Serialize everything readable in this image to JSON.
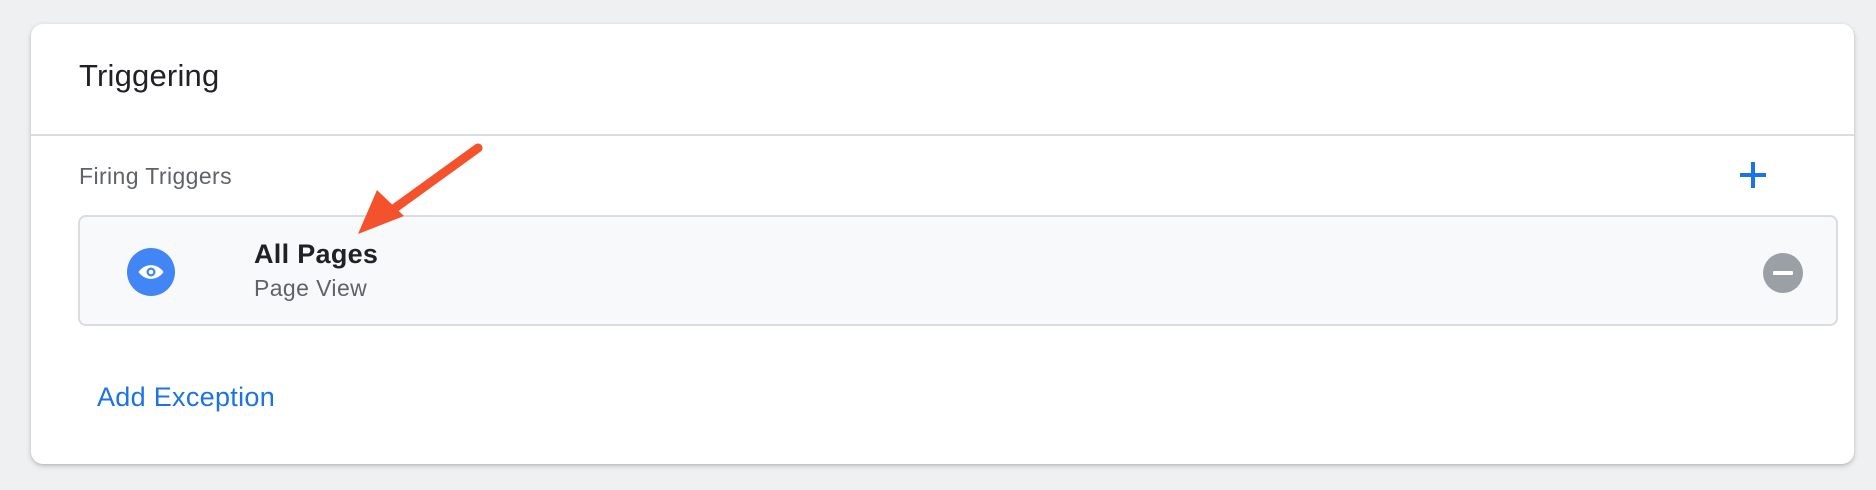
{
  "card": {
    "title": "Triggering"
  },
  "firing_triggers": {
    "label": "Firing Triggers",
    "add_icon": "plus-icon",
    "items": [
      {
        "name": "All Pages",
        "type": "Page View",
        "icon": "eye-icon",
        "remove_icon": "minus-circle-icon"
      }
    ]
  },
  "exceptions": {
    "add_label": "Add Exception"
  },
  "colors": {
    "accent": "#1a73e8",
    "trigger_icon_bg": "#4285f4",
    "remove_icon_bg": "#9aa0a6",
    "annotation_arrow": "#f4522d"
  }
}
